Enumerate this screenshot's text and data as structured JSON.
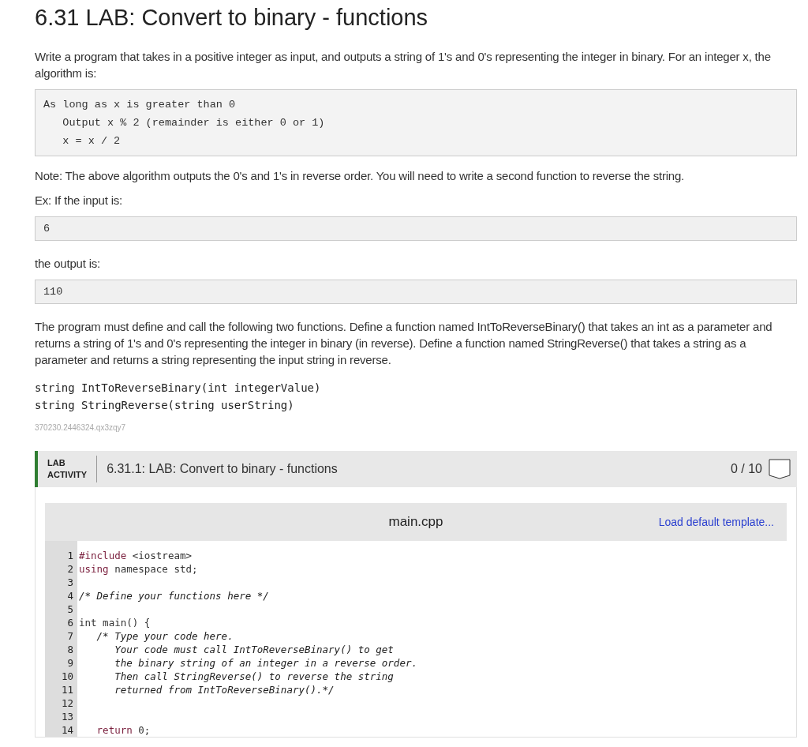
{
  "title": "6.31 LAB: Convert to binary - functions",
  "intro": "Write a program that takes in a positive integer as input, and outputs a string of 1's and 0's representing the integer in binary. For an integer x, the algorithm is:",
  "algorithm": [
    "As long as x is greater than 0",
    "   Output x % 2 (remainder is either 0 or 1)",
    "   x = x / 2"
  ],
  "note": "Note: The above algorithm outputs the 0's and 1's in reverse order. You will need to write a second function to reverse the string.",
  "example_label": "Ex: If the input is:",
  "example_input": "6",
  "output_label": "the output is:",
  "example_output": "110",
  "description": "The program must define and call the following two functions. Define a function named IntToReverseBinary() that takes an int as a parameter and returns a string of 1's and 0's representing the integer in binary (in reverse). Define a function named StringReverse() that takes a string as a parameter and returns a string representing the input string in reverse.",
  "signatures": [
    "string IntToReverseBinary(int integerValue)",
    "string StringReverse(string userString)"
  ],
  "reference_code": "370230.2446324.qx3zqy7",
  "lab": {
    "tag_line_1": "LAB",
    "tag_line_2": "ACTIVITY",
    "title": "6.31.1: LAB: Convert to binary - functions",
    "score": "0 / 10",
    "complete": false
  },
  "editor": {
    "filename": "main.cpp",
    "template_link": "Load default template...",
    "lines": [
      {
        "number": "1",
        "segments": [
          {
            "kind": "preproc",
            "text": "#include"
          },
          {
            "kind": "plain",
            "text": " <iostream>"
          }
        ]
      },
      {
        "number": "2",
        "segments": [
          {
            "kind": "keyword",
            "text": "using"
          },
          {
            "kind": "plain",
            "text": " namespace std;"
          }
        ]
      },
      {
        "number": "3"
      },
      {
        "number": "4",
        "segments": [
          {
            "kind": "comment",
            "text": "/* Define your functions here */"
          }
        ]
      },
      {
        "number": "5"
      },
      {
        "number": "6",
        "segments": [
          {
            "kind": "plain",
            "text": "int main() {"
          }
        ]
      },
      {
        "number": "7",
        "segments": [
          {
            "kind": "comment",
            "text": "   /* Type your code here."
          }
        ]
      },
      {
        "number": "8",
        "segments": [
          {
            "kind": "comment",
            "text": "      Your code must call IntToReverseBinary() to get"
          }
        ]
      },
      {
        "number": "9",
        "segments": [
          {
            "kind": "comment",
            "text": "      the binary string of an integer in a reverse order."
          }
        ]
      },
      {
        "number": "10",
        "segments": [
          {
            "kind": "comment",
            "text": "      Then call StringReverse() to reverse the string"
          }
        ]
      },
      {
        "number": "11",
        "segments": [
          {
            "kind": "comment",
            "text": "      returned from IntToReverseBinary().*/"
          }
        ]
      },
      {
        "number": "12"
      },
      {
        "number": "13"
      },
      {
        "number": "14",
        "segments": [
          {
            "kind": "keyword",
            "text": "   return"
          },
          {
            "kind": "plain",
            "text": " 0;"
          }
        ]
      }
    ]
  }
}
